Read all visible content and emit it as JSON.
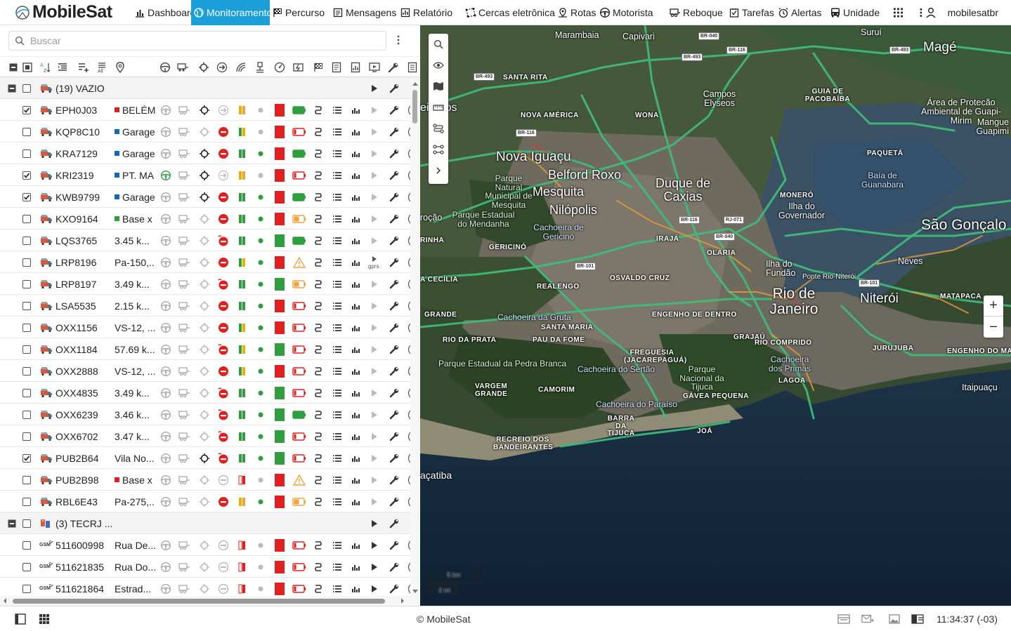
{
  "app": {
    "brand": "MobileSat"
  },
  "nav": [
    {
      "label": "Dashboard",
      "icon": "bar-chart-icon"
    },
    {
      "label": "Monitoramento",
      "icon": "globe-icon",
      "active": true
    },
    {
      "label": "Percurso",
      "icon": "checkered-flag-icon"
    },
    {
      "label": "Mensagens",
      "icon": "message-icon"
    },
    {
      "label": "Relatório",
      "icon": "report-chart-icon"
    },
    {
      "label": "Cercas eletrônicas",
      "icon": "geofence-icon"
    },
    {
      "label": "Rotas",
      "icon": "route-pin-icon"
    },
    {
      "label": "Motorista",
      "icon": "steering-wheel-icon"
    },
    {
      "label": "Reboque",
      "icon": "trailer-icon"
    },
    {
      "label": "Tarefas",
      "icon": "task-check-icon"
    },
    {
      "label": "Alertas",
      "icon": "alarm-clock-icon"
    },
    {
      "label": "Unidade",
      "icon": "bus-icon"
    }
  ],
  "user": {
    "name": "mobilesatbr"
  },
  "search": {
    "placeholder": "Buscar"
  },
  "groups": [
    {
      "title": "(19) VAZIO"
    },
    {
      "title": "(3) TECRJ ..."
    }
  ],
  "units": [
    {
      "plate": "EPH0J03",
      "location": "BELÉM",
      "status_color": "#e02020",
      "checked": true
    },
    {
      "plate": "KQP8C10",
      "location": "Garage",
      "status_color": "#1565c0",
      "checked": false
    },
    {
      "plate": "KRA7129",
      "location": "Garage",
      "status_color": "#1565c0",
      "checked": false
    },
    {
      "plate": "KRI2319",
      "location": "PT. MA",
      "status_color": "#1565c0",
      "checked": true
    },
    {
      "plate": "KWB9799",
      "location": "Garage",
      "status_color": "#1565c0",
      "checked": true
    },
    {
      "plate": "KXO9164",
      "location": "Base x",
      "status_color": "#2e9e3e",
      "checked": false
    },
    {
      "plate": "LQS3765",
      "location": "3.45 k...",
      "status_color": "",
      "checked": false
    },
    {
      "plate": "LRP8196",
      "location": "Pa-150,...",
      "status_color": "",
      "checked": false
    },
    {
      "plate": "LRP8197",
      "location": "3.49 k...",
      "status_color": "",
      "checked": false
    },
    {
      "plate": "LSA5535",
      "location": "2.15 k...",
      "status_color": "",
      "checked": false
    },
    {
      "plate": "OXX1156",
      "location": "VS-12, ...",
      "status_color": "",
      "checked": false
    },
    {
      "plate": "OXX1184",
      "location": "57.69 k...",
      "status_color": "",
      "checked": false
    },
    {
      "plate": "OXX2888",
      "location": "VS-12, ...",
      "status_color": "",
      "checked": false
    },
    {
      "plate": "OXX4835",
      "location": "3.49 k...",
      "status_color": "",
      "checked": false
    },
    {
      "plate": "OXX6239",
      "location": "3.46 k...",
      "status_color": "",
      "checked": false
    },
    {
      "plate": "OXX6702",
      "location": "3.47 k...",
      "status_color": "",
      "checked": false
    },
    {
      "plate": "PUB2B64",
      "location": "Vila No...",
      "status_color": "",
      "checked": true
    },
    {
      "plate": "PUB2B98",
      "location": "Base x",
      "status_color": "#e02020",
      "checked": false
    },
    {
      "plate": "RBL6E43",
      "location": "Pa-275,...",
      "status_color": "",
      "checked": false
    }
  ],
  "units_group2": [
    {
      "plate": "511600998",
      "location": "Rua De..."
    },
    {
      "plate": "511621835",
      "location": "Rua Do..."
    },
    {
      "plate": "511621864",
      "location": "Estrad..."
    }
  ],
  "map": {
    "labels": {
      "marambaia": "Marambaia",
      "capivari": "Capivari",
      "mage": "Magé",
      "surui": "Suruí",
      "santa_rita": "SANTA RITA",
      "campos": "Campos Elyseos",
      "guia": "GUIA DE PACOBAÍBA",
      "apa": "Área de Protecão Ambiental de Guapi-Mirim",
      "mangue": "Mangue Guapimi",
      "nova_america": "NOVA AMÉRICA",
      "wona": "WONA",
      "nova_iguacu": "Nova Iguaçu",
      "belford": "Belford Roxo",
      "mesquita": "Mesquita",
      "duque": "Duque de Caxias",
      "nilopolis": "Nilópolis",
      "paqueta": "PAQUETÁ",
      "baia": "Baía de Guanabara",
      "parque_mesquita": "Parque Natural Municipal de Mesquita",
      "pe_mendanha": "Parque Estadual do Mendanha",
      "cach_gericino": "Cachoeira de Gericinó",
      "monero": "MONERÓ",
      "ilha_gov": "Ilha do Governador",
      "sao_goncalo": "São Gonçalo",
      "iraja": "IRAJÁ",
      "olaria": "OLARIA",
      "gericino": "GERICINÓ",
      "rinha": "RINHA",
      "rocao": "roção",
      "eirados": "eirados",
      "ilha_fundao": "Ilha do Fundão",
      "neves": "Neves",
      "ponte": "Ponte Rio-Niterói",
      "niteroi": "Niterói",
      "rio": "Rio de Janeiro",
      "matapaca": "MATAPACA",
      "cecilia": "A CECÍLIA",
      "realengo": "REALENGO",
      "osvaldo": "OSVALDO CRUZ",
      "engenho": "ENGENHO DE DENTRO",
      "grande": "GRANDE",
      "cach_gruta": "Cachoeira da Gruta",
      "santa_maria": "SANTA MARIA",
      "grajau": "GRAJAÚ",
      "rio_comprido": "RIO COMPRIDO",
      "rio_prata": "RIO DA PRATA",
      "pau_fome": "PAU DA FOME",
      "jurujuba": "JURUJUBA",
      "engenho_mato": "ENGENHO DO MA",
      "freguesia": "FREGUESIA (JACAREPAGUÁ)",
      "pe_pedra": "Parque Estadual da Pedra Branca",
      "cach_sertao": "Cachoeira do Sertão",
      "pn_tijuca": "Parque Nacional da Tijuca",
      "cach_primas": "Cachoeira dos Primas",
      "vargem": "VARGEM GRANDE",
      "camorim": "CAMORIM",
      "gavea": "GÁVEA PEQUENA",
      "lagoa": "LAGOA",
      "itaipuacu": "Itaipuaçu",
      "cach_paraiso": "Cachoeira do Paraíso",
      "barra": "BARRA DA TIJUCA",
      "joa": "JOÁ",
      "recreio": "RECREIO DOS BANDEIRANTES",
      "acatiba": "açatiba"
    },
    "scale_km": "5 km",
    "scale_mi": "2 mi",
    "zoom_in": "+",
    "zoom_out": "−"
  },
  "footer": {
    "copyright": "© MobileSat",
    "clock": "11:34:37 (-03)"
  }
}
